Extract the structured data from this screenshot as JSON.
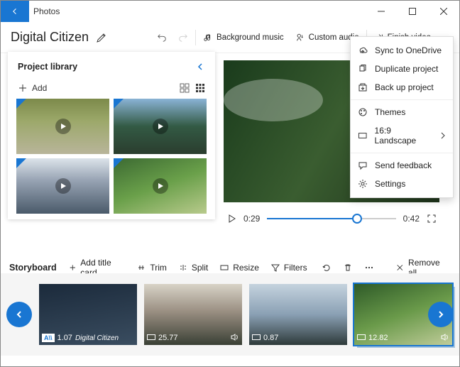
{
  "window": {
    "back": "←",
    "title": "Photos"
  },
  "project": {
    "name": "Digital Citizen"
  },
  "toolbar": {
    "undo": "Undo",
    "redo": "Redo",
    "bg_music": "Background music",
    "custom_audio": "Custom audio",
    "finish": "Finish video"
  },
  "library": {
    "title": "Project library",
    "add": "Add"
  },
  "player": {
    "current": "0:29",
    "total": "0:42"
  },
  "story": {
    "label": "Storyboard",
    "add_title": "Add title card",
    "trim": "Trim",
    "split": "Split",
    "resize": "Resize",
    "filters": "Filters",
    "remove_all": "Remove all"
  },
  "clips": [
    {
      "duration": "1.07",
      "title": "Digital Citizen",
      "badge": "A\\\\"
    },
    {
      "duration": "25.77"
    },
    {
      "duration": "0.87"
    },
    {
      "duration": "12.82"
    }
  ],
  "menu": {
    "sync": "Sync to OneDrive",
    "duplicate": "Duplicate project",
    "backup": "Back up project",
    "themes": "Themes",
    "aspect": "16:9 Landscape",
    "feedback": "Send feedback",
    "settings": "Settings"
  }
}
